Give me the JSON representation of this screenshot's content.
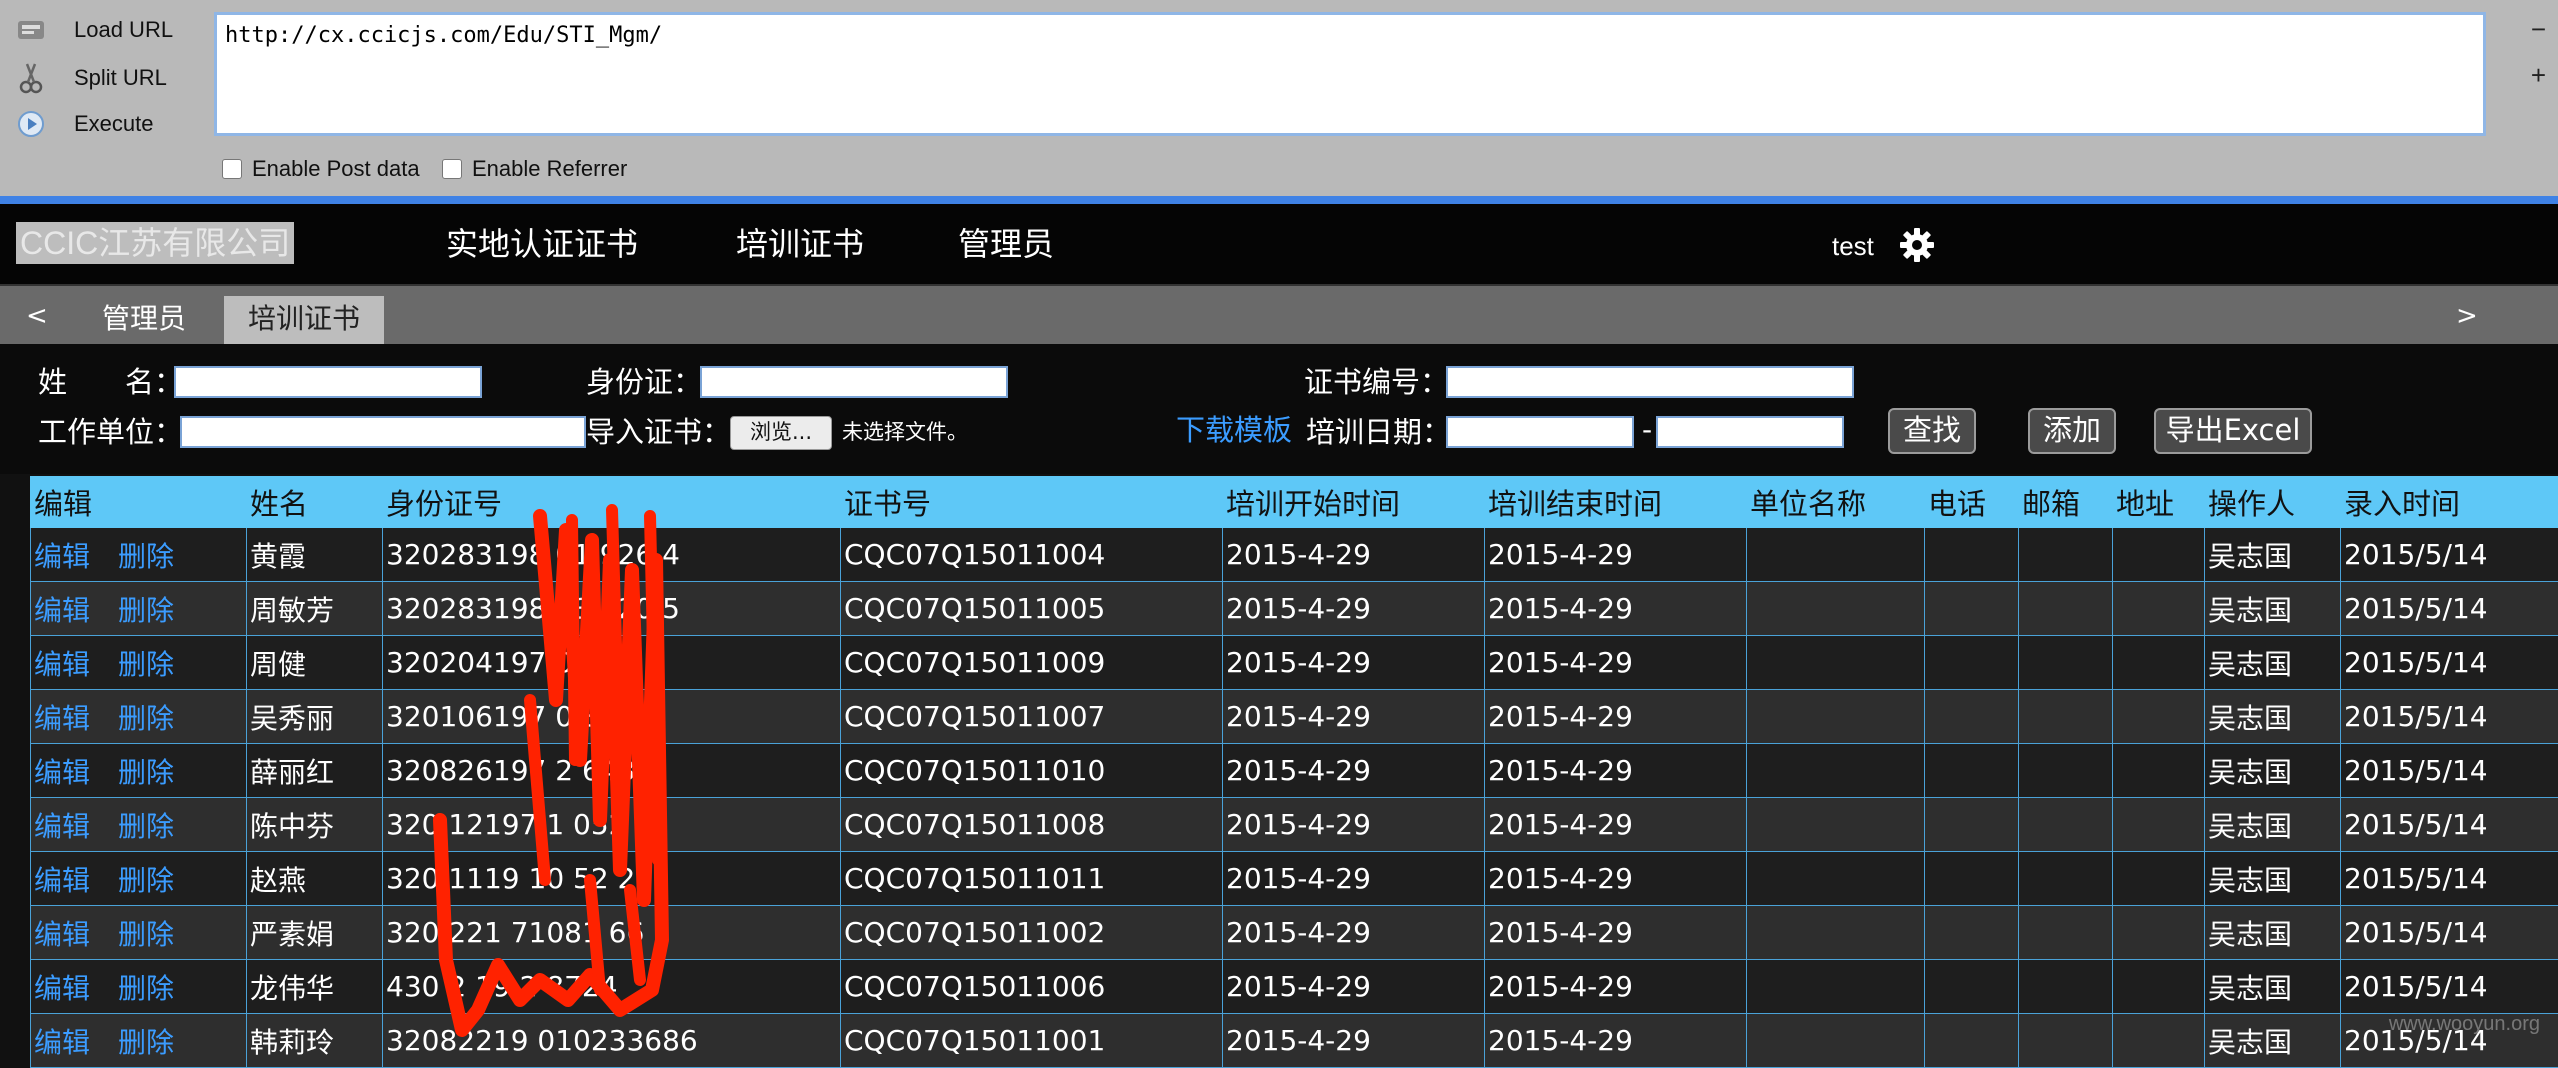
{
  "hackbar": {
    "load_url": "Load URL",
    "split_url": "Split URL",
    "execute": "Execute",
    "url_value": "http://cx.ccicjs.com/Edu/STI_Mgm/",
    "minus": "−",
    "plus": "+",
    "enable_post": "Enable Post data",
    "enable_referrer": "Enable Referrer"
  },
  "navbar": {
    "brand": "CCIC江苏有限公司",
    "items": [
      "实地认证证书",
      "培训证书",
      "管理员"
    ],
    "user": "test"
  },
  "tabs": {
    "prev": "<",
    "next": ">",
    "items": [
      "管理员",
      "培训证书"
    ],
    "active_index": 1
  },
  "form": {
    "name_label": "姓　　名：",
    "id_label": "身份证：",
    "cert_no_label": "证书编号：",
    "company_label": "工作单位：",
    "import_label": "导入证书：",
    "browse": "浏览...",
    "no_file": "未选择文件。",
    "download_template": "下载模板",
    "train_date_label": "培训日期：",
    "date_sep": "-",
    "search_btn": "查找",
    "add_btn": "添加",
    "export_btn": "导出Excel"
  },
  "table": {
    "headers": [
      "编辑",
      "姓名",
      "身份证号",
      "证书号",
      "培训开始时间",
      "培训结束时间",
      "单位名称",
      "电话",
      "邮箱",
      "地址",
      "操作人",
      "录入时间"
    ],
    "edit_label": "编辑",
    "delete_label": "删除",
    "rows": [
      {
        "name": "黄霞",
        "id": "320283198  01  926  4",
        "cert": "CQC07Q15011004",
        "start": "2015-4-29",
        "end": "2015-4-29",
        "company": "",
        "phone": "",
        "email": "",
        "addr": "",
        "operator": "吴志国",
        "created": "2015/5/14"
      },
      {
        "name": "周敏芳",
        "id": "320283198  03  220  5",
        "cert": "CQC07Q15011005",
        "start": "2015-4-29",
        "end": "2015-4-29",
        "company": "",
        "phone": "",
        "email": "",
        "addr": "",
        "operator": "吴志国",
        "created": "2015/5/14"
      },
      {
        "name": "周健",
        "id": "320204197  0  60  11",
        "cert": "CQC07Q15011009",
        "start": "2015-4-29",
        "end": "2015-4-29",
        "company": "",
        "phone": "",
        "email": "",
        "addr": "",
        "operator": "吴志国",
        "created": "2015/5/14"
      },
      {
        "name": "吴秀丽",
        "id": "320106197   0  842",
        "cert": "CQC07Q15011007",
        "start": "2015-4-29",
        "end": "2015-4-29",
        "company": "",
        "phone": "",
        "email": "",
        "addr": "",
        "operator": "吴志国",
        "created": "2015/5/14"
      },
      {
        "name": "薛丽红",
        "id": "320826197   2  643",
        "cert": "CQC07Q15011010",
        "start": "2015-4-29",
        "end": "2015-4-29",
        "company": "",
        "phone": "",
        "email": "",
        "addr": "",
        "operator": "吴志国",
        "created": "2015/5/14"
      },
      {
        "name": "陈中芬",
        "id": "320  12197   1  052  1",
        "cert": "CQC07Q15011008",
        "start": "2015-4-29",
        "end": "2015-4-29",
        "company": "",
        "phone": "",
        "email": "",
        "addr": "",
        "operator": "吴志国",
        "created": "2015/5/14"
      },
      {
        "name": "赵燕",
        "id": "320  1119  10  52  2",
        "cert": "CQC07Q15011011",
        "start": "2015-4-29",
        "end": "2015-4-29",
        "company": "",
        "phone": "",
        "email": "",
        "addr": "",
        "operator": "吴志国",
        "created": "2015/5/14"
      },
      {
        "name": "严素娟",
        "id": "320  221  71081  66",
        "cert": "CQC07Q15011002",
        "start": "2015-4-29",
        "end": "2015-4-29",
        "company": "",
        "phone": "",
        "email": "",
        "addr": "",
        "operator": "吴志国",
        "created": "2015/5/14"
      },
      {
        "name": "龙伟华",
        "id": "430  2  19  2  8724",
        "cert": "CQC07Q15011006",
        "start": "2015-4-29",
        "end": "2015-4-29",
        "company": "",
        "phone": "",
        "email": "",
        "addr": "",
        "operator": "吴志国",
        "created": "2015/5/14"
      },
      {
        "name": "韩莉玲",
        "id": "32082219  010233686",
        "cert": "CQC07Q15011001",
        "start": "2015-4-29",
        "end": "2015-4-29",
        "company": "",
        "phone": "",
        "email": "",
        "addr": "",
        "operator": "吴志国",
        "created": "2015/5/14"
      }
    ]
  },
  "watermark": "www.wooyun.org",
  "colors": {
    "header_bg": "#5ec8f7",
    "link": "#3b9cff",
    "scribble": "#ff2200",
    "hackbar_sep": "#3f82e6"
  }
}
